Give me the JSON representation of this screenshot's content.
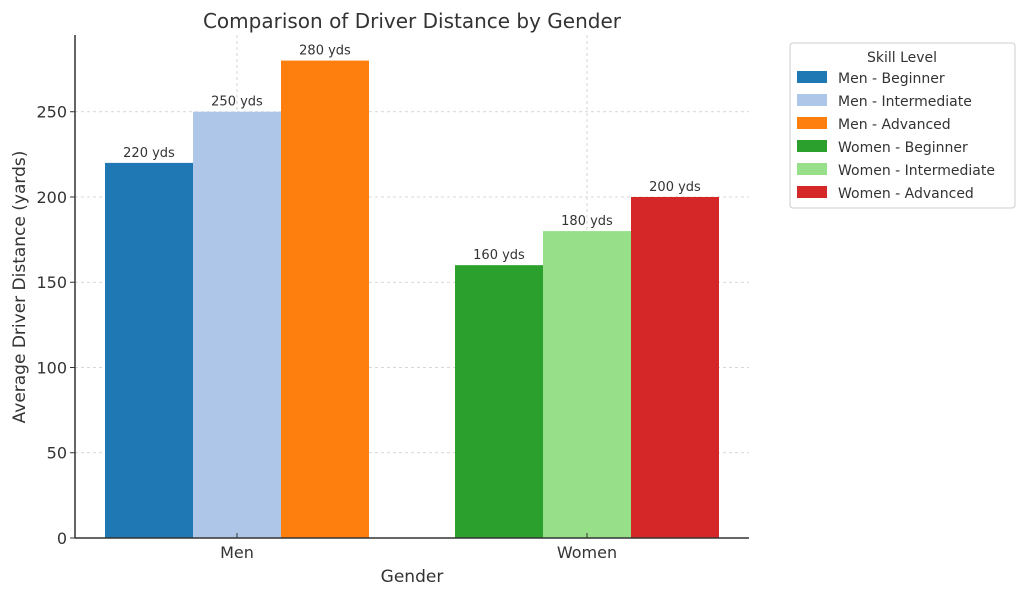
{
  "chart_data": {
    "type": "bar",
    "title": "Comparison of Driver Distance by Gender",
    "xlabel": "Gender",
    "ylabel": "Average Driver Distance (yards)",
    "categories": [
      "Men",
      "Women"
    ],
    "ylim": [
      0,
      295
    ],
    "yticks": [
      0,
      50,
      100,
      150,
      200,
      250
    ],
    "grid": true,
    "legend_title": "Skill Level",
    "legend_position": "outside-top-right",
    "value_suffix": " yds",
    "bars": [
      {
        "name": "Men - Beginner",
        "category": "Men",
        "value": 220,
        "color": "#1f77b4"
      },
      {
        "name": "Men - Intermediate",
        "category": "Men",
        "value": 250,
        "color": "#aec7e8"
      },
      {
        "name": "Men - Advanced",
        "category": "Men",
        "value": 280,
        "color": "#ff7f0e"
      },
      {
        "name": "Women - Beginner",
        "category": "Women",
        "value": 160,
        "color": "#2ca02c"
      },
      {
        "name": "Women - Intermediate",
        "category": "Women",
        "value": 180,
        "color": "#98df8a"
      },
      {
        "name": "Women - Advanced",
        "category": "Women",
        "value": 200,
        "color": "#d62728"
      }
    ]
  }
}
